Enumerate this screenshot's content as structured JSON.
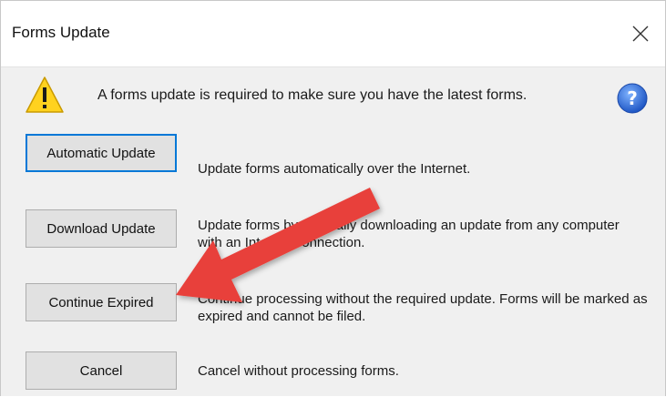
{
  "window": {
    "title": "Forms Update",
    "close_icon": "close-icon"
  },
  "header": {
    "message": "A forms update is required to make sure you have the latest forms.",
    "warning_icon": "warning-icon",
    "help_icon": "help-icon"
  },
  "options": [
    {
      "button_label": "Automatic Update",
      "description": "Update forms automatically over the Internet."
    },
    {
      "button_label": "Download Update",
      "description": "Update forms by manually downloading an update from any computer with an Internet connection."
    },
    {
      "button_label": "Continue Expired",
      "description": "Continue processing without the required update. Forms will be marked as expired and cannot be filed."
    },
    {
      "button_label": "Cancel",
      "description": "Cancel without processing forms."
    }
  ],
  "annotation": {
    "arrow_icon": "red-arrow-icon",
    "arrow_color": "#e8413a"
  },
  "colors": {
    "default_button_border": "#0078d7",
    "dialog_body": "#f0f0f0",
    "help_blue": "#2b6fd6",
    "warning_yellow": "#ffd21f"
  }
}
